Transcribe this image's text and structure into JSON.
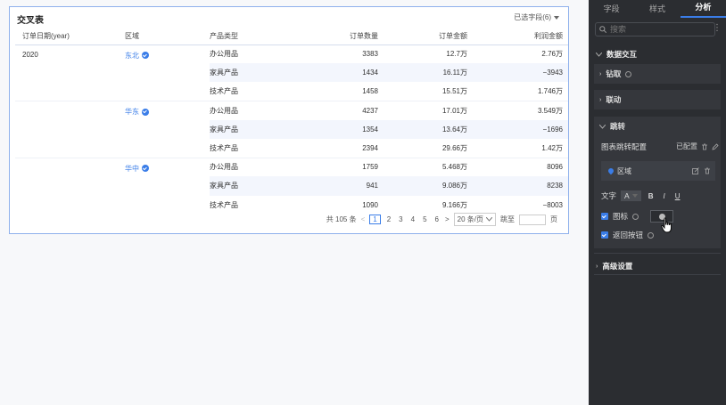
{
  "table": {
    "title": "交叉表",
    "selected_fields": "已选字段(6)",
    "headers": [
      "订单日期(year)",
      "区域",
      "产品类型",
      "订单数量",
      "订单金额",
      "利润金额"
    ],
    "year": "2020",
    "groups": [
      {
        "region": "东北",
        "rows": [
          {
            "type": "办公用品",
            "qty": "3383",
            "amount": "12.7万",
            "profit": "2.76万"
          },
          {
            "type": "家具产品",
            "qty": "1434",
            "amount": "16.11万",
            "profit": "−3943"
          },
          {
            "type": "技术产品",
            "qty": "1458",
            "amount": "15.51万",
            "profit": "1.746万"
          }
        ]
      },
      {
        "region": "华东",
        "rows": [
          {
            "type": "办公用品",
            "qty": "4237",
            "amount": "17.01万",
            "profit": "3.549万"
          },
          {
            "type": "家具产品",
            "qty": "1354",
            "amount": "13.64万",
            "profit": "−1696"
          },
          {
            "type": "技术产品",
            "qty": "2394",
            "amount": "29.66万",
            "profit": "1.42万"
          }
        ]
      },
      {
        "region": "华中",
        "rows": [
          {
            "type": "办公用品",
            "qty": "1759",
            "amount": "5.468万",
            "profit": "8096"
          },
          {
            "type": "家具产品",
            "qty": "941",
            "amount": "9.086万",
            "profit": "8238"
          },
          {
            "type": "技术产品",
            "qty": "1090",
            "amount": "9.166万",
            "profit": "−8003"
          }
        ]
      }
    ],
    "pager": {
      "total": "共 105 条",
      "prev": "<",
      "pages": [
        "1",
        "2",
        "3",
        "4",
        "5",
        "6"
      ],
      "next": ">",
      "page_size": "20 条/页",
      "goto": "跳至",
      "page_unit": "页"
    }
  },
  "panel": {
    "tabs": [
      "字段",
      "样式",
      "分析"
    ],
    "search_placeholder": "搜索",
    "section": "数据交互",
    "drill": "钻取",
    "link": "联动",
    "jump": "跳转",
    "jump_config": "图表跳转配置",
    "configured": "已配置",
    "field_chip": "区域",
    "text_label": "文字",
    "font_a": "A",
    "bold": "B",
    "italic": "I",
    "underline": "U",
    "icon_label": "图标",
    "back_label": "返回按钮",
    "advanced": "高级设置"
  },
  "colors": {
    "accent": "#3a7de8",
    "panel_bg": "#2b2d31"
  }
}
